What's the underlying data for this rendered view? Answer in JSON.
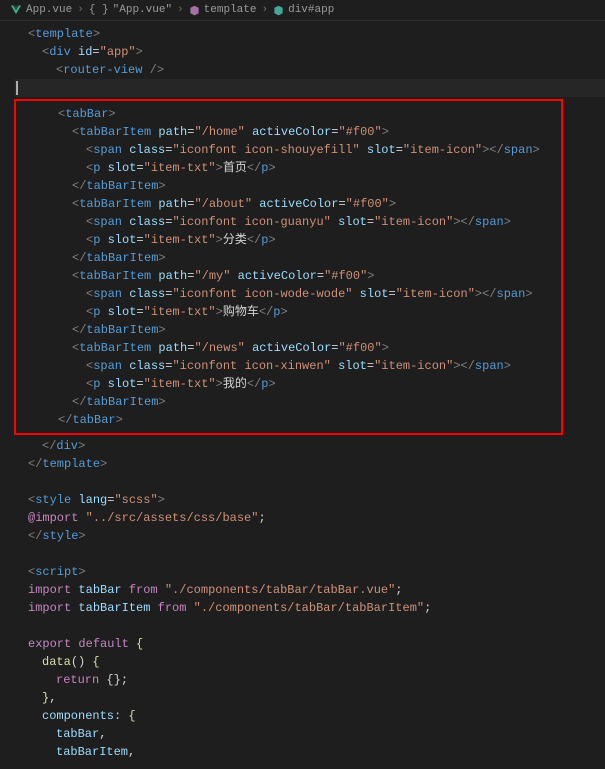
{
  "breadcrumb": {
    "file": "App.vue",
    "json_label": "\"App.vue\"",
    "template": "template",
    "div": "div#app"
  },
  "code": {
    "template_open": "template",
    "div_open": "div",
    "div_id_attr": "id",
    "div_id_val": "\"app\"",
    "router_view": "router-view",
    "tabBar": "tabBar",
    "tabBarItem": "tabBarItem",
    "path_attr": "path",
    "activeColor_attr": "activeColor",
    "activeColor_val": "\"#f00\"",
    "span": "span",
    "class_attr": "class",
    "slot_attr": "slot",
    "item_icon_val": "\"item-icon\"",
    "item_txt_val": "\"item-txt\"",
    "p_tag": "p",
    "items": [
      {
        "path": "\"/home\"",
        "icon_class": "\"iconfont icon-shouyefill\"",
        "txt": "首页"
      },
      {
        "path": "\"/about\"",
        "icon_class": "\"iconfont icon-guanyu\"",
        "txt": "分类"
      },
      {
        "path": "\"/my\"",
        "icon_class": "\"iconfont icon-wode-wode\"",
        "txt": "购物车"
      },
      {
        "path": "\"/news\"",
        "icon_class": "\"iconfont icon-xinwen\"",
        "txt": "我的"
      }
    ],
    "div_close": "div",
    "template_close": "template",
    "style_tag": "style",
    "lang_attr": "lang",
    "lang_val": "\"scss\"",
    "import_stmt": "@import",
    "import_path": "\"../src/assets/css/base\"",
    "script_tag": "script",
    "import_kw": "import",
    "from_kw": "from",
    "tabBar_id": "tabBar",
    "tabBar_path": "\"./components/tabBar/tabBar.vue\"",
    "tabBarItem_id": "tabBarItem",
    "tabBarItem_path": "\"./components/tabBar/tabBarItem\"",
    "export_kw": "export",
    "default_kw": "default",
    "data_fn": "data",
    "return_kw": "return",
    "components_key": "components:",
    "comp1": "tabBar",
    "comp2": "tabBarItem"
  }
}
